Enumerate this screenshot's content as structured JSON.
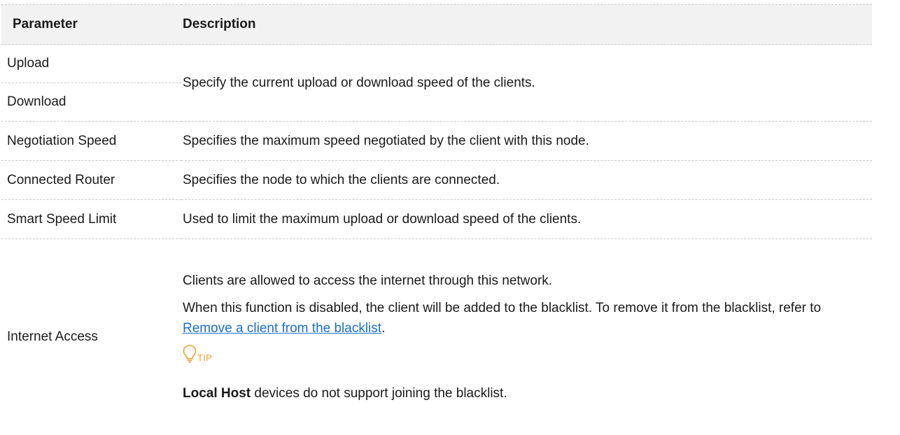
{
  "table": {
    "headers": {
      "parameter": "Parameter",
      "description": "Description"
    },
    "rows": {
      "upload": "Upload",
      "download": "Download",
      "upload_download_desc": "Specify the current upload or download speed of the clients.",
      "negotiation_speed": "Negotiation Speed",
      "negotiation_speed_desc": "Specifies the maximum speed negotiated by the client with this node.",
      "connected_router": "Connected Router",
      "connected_router_desc": "Specifies the node to which the clients are connected.",
      "smart_speed_limit": "Smart Speed Limit",
      "smart_speed_limit_desc": "Used to limit the maximum upload or download speed of the clients.",
      "internet_access": "Internet Access",
      "internet_access_desc1": "Clients are allowed to access the internet through this network.",
      "internet_access_desc2_prefix": "When this function is disabled, the client will be added to the blacklist. To remove it from the blacklist, refer to ",
      "internet_access_link": "Remove a client from the blacklist",
      "internet_access_desc2_suffix": ".",
      "tip_label": "TIP",
      "tip_icon": "lightbulb-icon",
      "note_bold": "Local Host",
      "note_rest": " devices do not support joining the blacklist."
    }
  },
  "colors": {
    "header_bg": "#f2f2f2",
    "link": "#1a6fc9",
    "tip_accent": "#f0a030",
    "divider": "#c9c9c9"
  }
}
